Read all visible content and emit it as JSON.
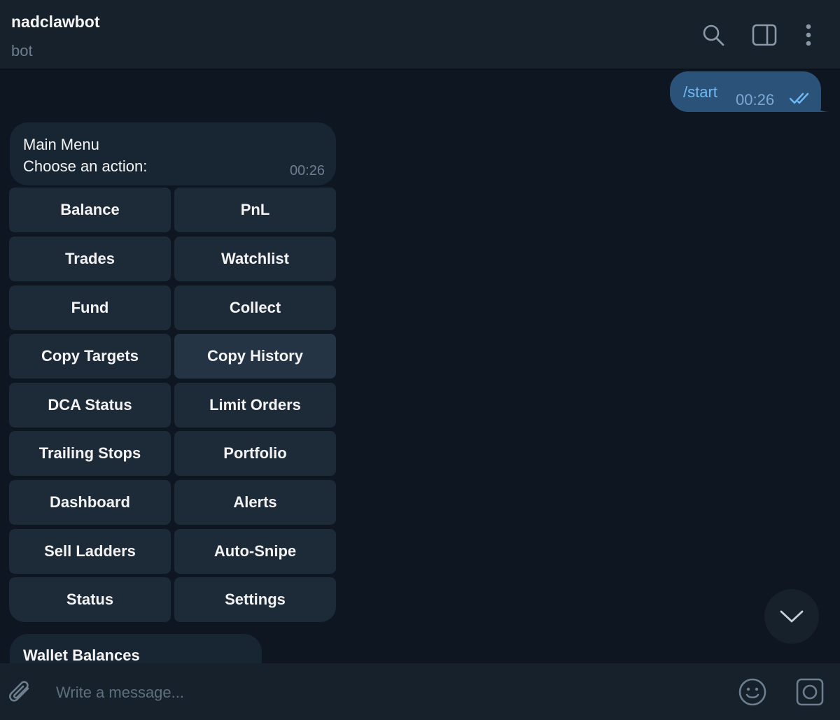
{
  "header": {
    "title": "nadclawbot",
    "subtitle": "bot"
  },
  "outgoing": {
    "text": "/start",
    "time": "00:26"
  },
  "menu_message": {
    "title": "Main Menu",
    "subtitle": "Choose an action:",
    "time": "00:26"
  },
  "keyboard": {
    "rows": [
      [
        "Balance",
        "PnL"
      ],
      [
        "Trades",
        "Watchlist"
      ],
      [
        "Fund",
        "Collect"
      ],
      [
        "Copy Targets",
        "Copy History"
      ],
      [
        "DCA Status",
        "Limit Orders"
      ],
      [
        "Trailing Stops",
        "Portfolio"
      ],
      [
        "Dashboard",
        "Alerts"
      ],
      [
        "Sell Ladders",
        "Auto-Snipe"
      ],
      [
        "Status",
        "Settings"
      ]
    ]
  },
  "wallet_message": {
    "title": "Wallet Balances"
  },
  "composer": {
    "placeholder": "Write a message..."
  },
  "colors": {
    "background": "#0e1621",
    "header": "#17212b",
    "outgoing_bubble": "#2b5278",
    "incoming_bubble": "#182533",
    "keyboard_button": "#1d2a38",
    "accent": "#71b9f5"
  },
  "icons": {
    "header": [
      "search-icon",
      "sidebar-toggle-icon",
      "more-vertical-icon"
    ],
    "composer": [
      "paperclip-icon",
      "emoji-icon",
      "camera-icon"
    ],
    "scroll": "chevron-down-icon",
    "status": "double-check-icon"
  }
}
